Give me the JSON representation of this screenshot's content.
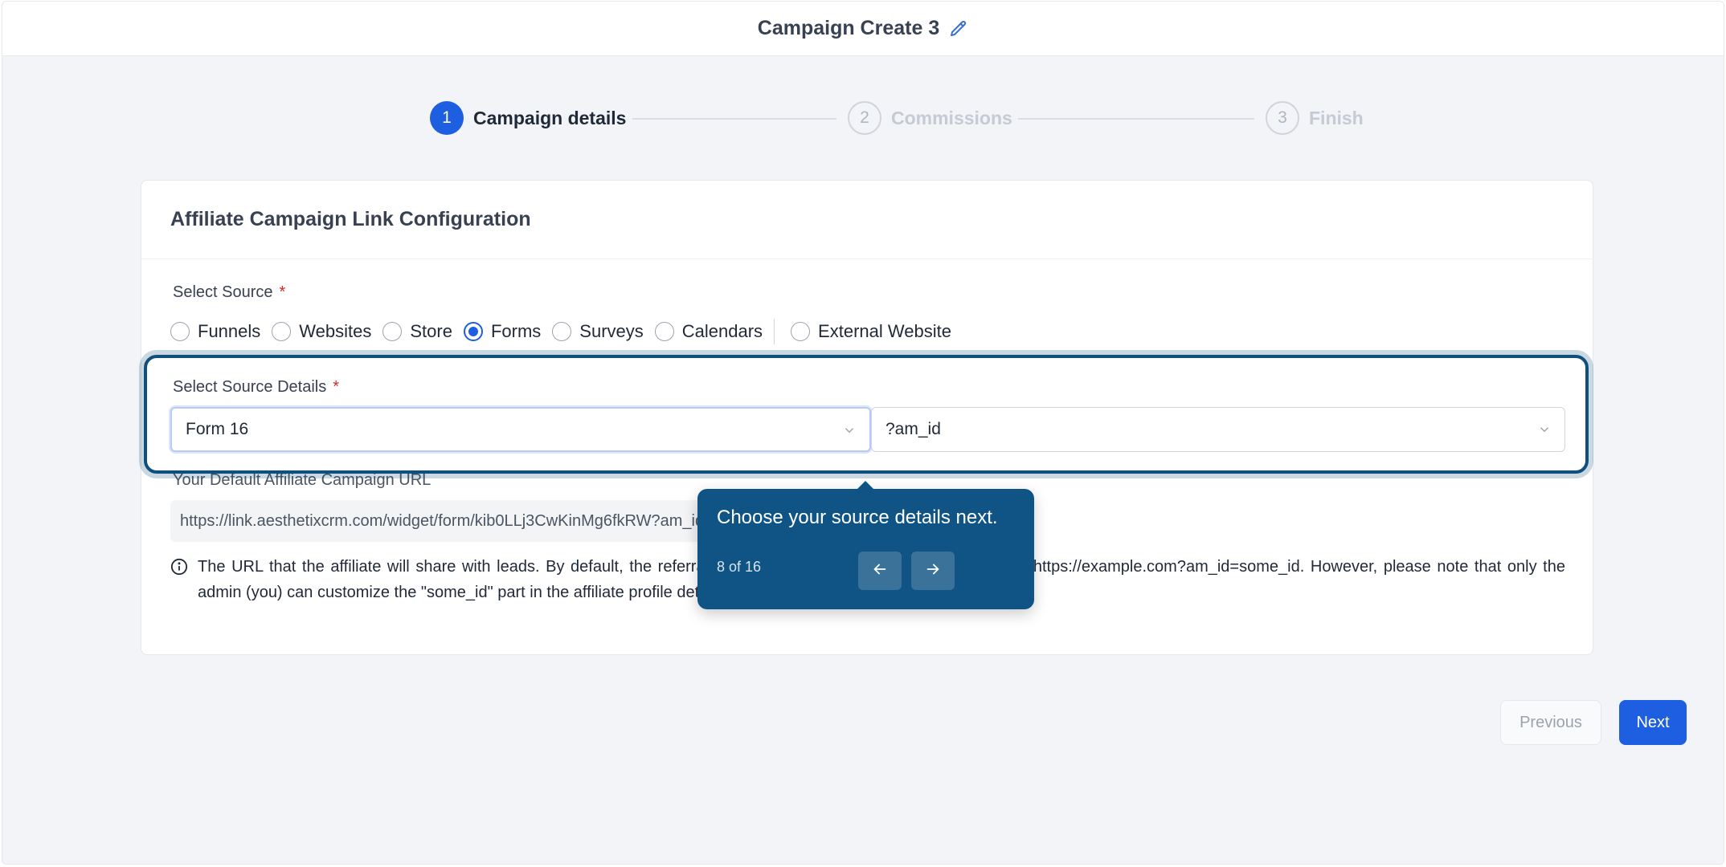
{
  "header": {
    "title": "Campaign Create 3",
    "edit_icon": "pencil-icon"
  },
  "stepper": {
    "steps": [
      {
        "number": "1",
        "label": "Campaign details"
      },
      {
        "number": "2",
        "label": "Commissions"
      },
      {
        "number": "3",
        "label": "Finish"
      }
    ]
  },
  "card": {
    "title": "Affiliate Campaign Link Configuration",
    "select_source_label": "Select Source",
    "required_mark": "*",
    "sources": [
      "Funnels",
      "Websites",
      "Store",
      "Forms",
      "Surveys",
      "Calendars"
    ],
    "external_source": "External Website",
    "selected_source": "Forms",
    "select_source_details_label": "Select Source Details",
    "source_detail_value": "Form 16",
    "param_value": "?am_id",
    "default_url_label": "Your Default Affiliate Campaign URL",
    "default_url": "https://link.aesthetixcrm.com/widget/form/kib0LLj3CwKinMg6fkRW?am_id=some_id",
    "info_text": "The URL that the affiliate will share with leads. By default, the referral URL for the affiliate will be in the format of https://example.com?am_id=some_id. However, please note that only the admin (you) can customize the \"some_id\" part in the affiliate profile detail page."
  },
  "tooltip": {
    "text": "Choose your source details next.",
    "count": "8 of 16"
  },
  "footer": {
    "previous_label": "Previous",
    "next_label": "Next"
  },
  "colors": {
    "primary": "#1d5fe0",
    "tour": "#0f5484",
    "required": "#dc2626"
  }
}
